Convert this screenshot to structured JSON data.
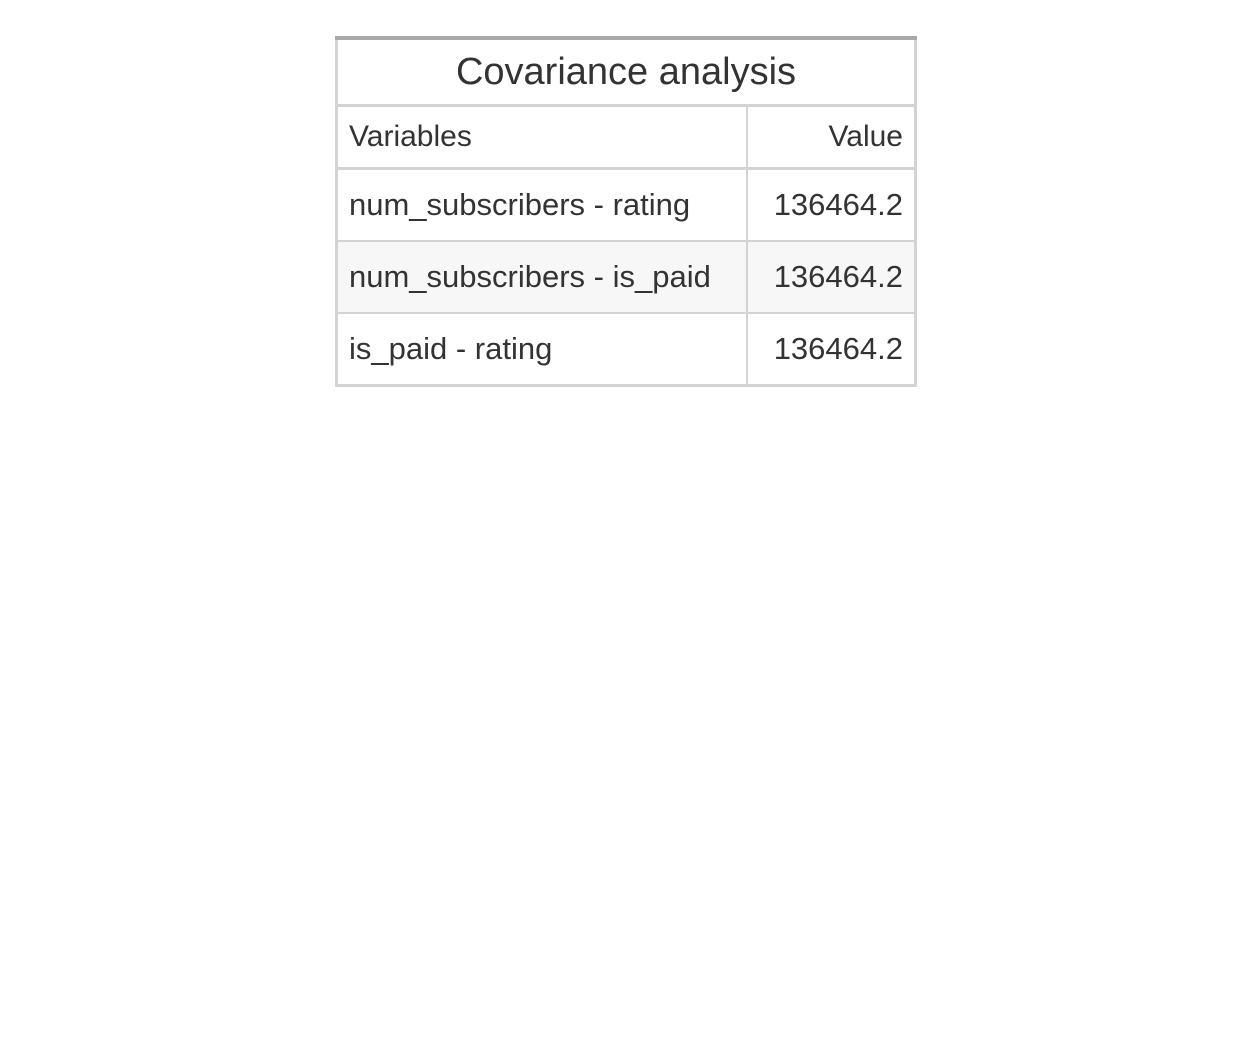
{
  "chart_data": {
    "type": "table",
    "title": "Covariance analysis",
    "columns": [
      "Variables",
      "Value"
    ],
    "rows": [
      {
        "variables": "num_subscribers - rating",
        "value": "136464.2"
      },
      {
        "variables": "num_subscribers - is_paid",
        "value": "136464.2"
      },
      {
        "variables": "is_paid - rating",
        "value": "136464.2"
      }
    ]
  },
  "colors": {
    "text": "#333333",
    "border": "#d3d3d3",
    "top_border": "#a9a9a9",
    "stripe": "#f7f7f7"
  }
}
